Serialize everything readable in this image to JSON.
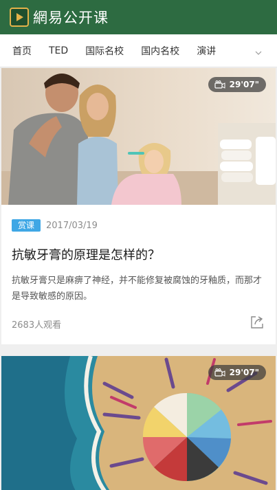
{
  "header": {
    "app_name": "網易公开课"
  },
  "nav": {
    "items": [
      "首页",
      "TED",
      "国际名校",
      "国内名校",
      "演讲"
    ]
  },
  "cards": [
    {
      "duration": "29'07\"",
      "badge": "赏课",
      "date": "2017/03/19",
      "title": "抗敏牙膏的原理是怎样的？",
      "description": "抗敏牙膏只是麻痹了神经，并不能修复被腐蚀的牙釉质，而那才是导致敏感的原因。",
      "views": "2683人观看"
    },
    {
      "duration": "29'07\""
    }
  ],
  "colors": {
    "header_bg": "#2d6b41",
    "badge_bg": "#3fa7e5",
    "logo_border": "#e4b24a"
  }
}
